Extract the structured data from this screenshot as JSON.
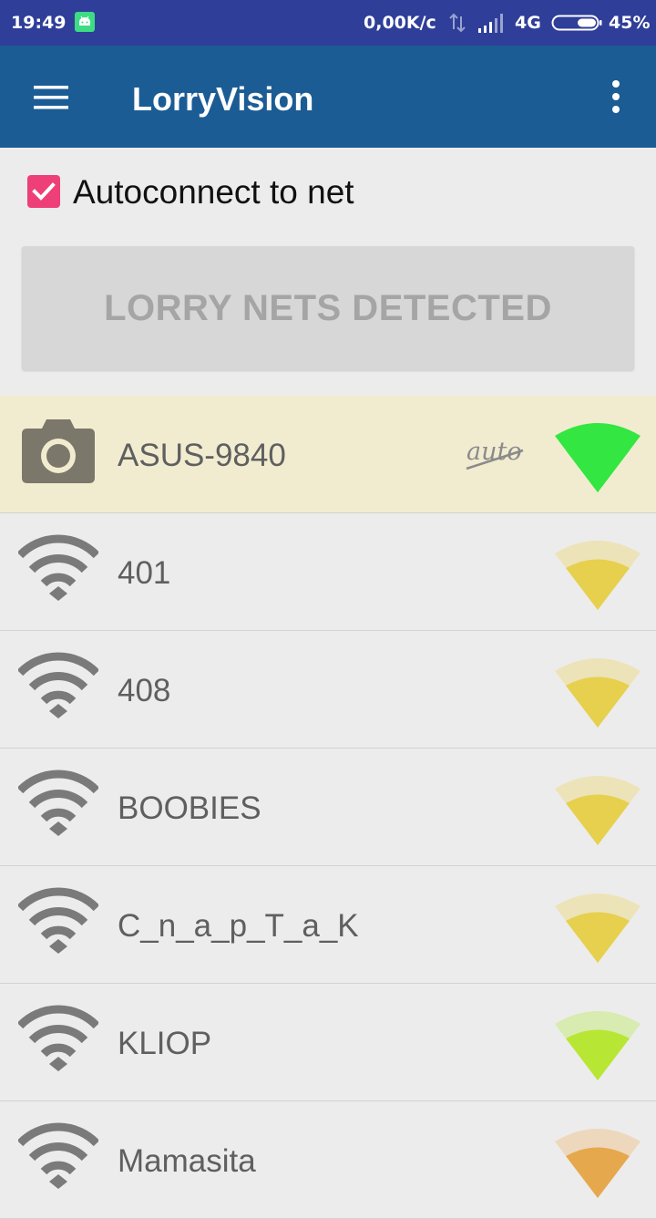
{
  "status_bar": {
    "time": "19:49",
    "speed": "0,00K/c",
    "network": "4G",
    "battery": "45%",
    "battery_level": 0.45,
    "icons": [
      "android-icon",
      "data-arrows-icon",
      "signal-icon",
      "battery-icon"
    ]
  },
  "app_bar": {
    "title": "LorryVision",
    "icons": [
      "menu-icon",
      "overflow-icon"
    ]
  },
  "autoconnect": {
    "label": "Autoconnect to net",
    "checked": true
  },
  "detect_button": {
    "label": "LORRY NETS DETECTED"
  },
  "networks": [
    {
      "name": "ASUS-9840",
      "icon": "camera-icon",
      "auto_tag": "auto",
      "auto_disabled": true,
      "selected": true,
      "signal_color": "#33e641",
      "signal_light": "#33e641"
    },
    {
      "name": "401",
      "icon": "wifi-icon",
      "selected": false,
      "signal_color": "#e6d04d",
      "signal_light": "#ede3b8"
    },
    {
      "name": "408",
      "icon": "wifi-icon",
      "selected": false,
      "signal_color": "#e6d04d",
      "signal_light": "#ede3b8"
    },
    {
      "name": "BOOBIES",
      "icon": "wifi-icon",
      "selected": false,
      "signal_color": "#e6d04d",
      "signal_light": "#ede3b8"
    },
    {
      "name": "C_n_a_p_T_a_K",
      "icon": "wifi-icon",
      "selected": false,
      "signal_color": "#e6d04d",
      "signal_light": "#ede3b8"
    },
    {
      "name": "KLIOP",
      "icon": "wifi-icon",
      "selected": false,
      "signal_color": "#b8e634",
      "signal_light": "#d8ebb0"
    },
    {
      "name": "Mamasita",
      "icon": "wifi-icon",
      "selected": false,
      "signal_color": "#e6a84d",
      "signal_light": "#eed8bd"
    }
  ],
  "colors": {
    "status_bar": "#2f3e98",
    "app_bar": "#1b5c94",
    "checkbox": "#ee3f78",
    "selected_row": "#f1ecd0"
  }
}
